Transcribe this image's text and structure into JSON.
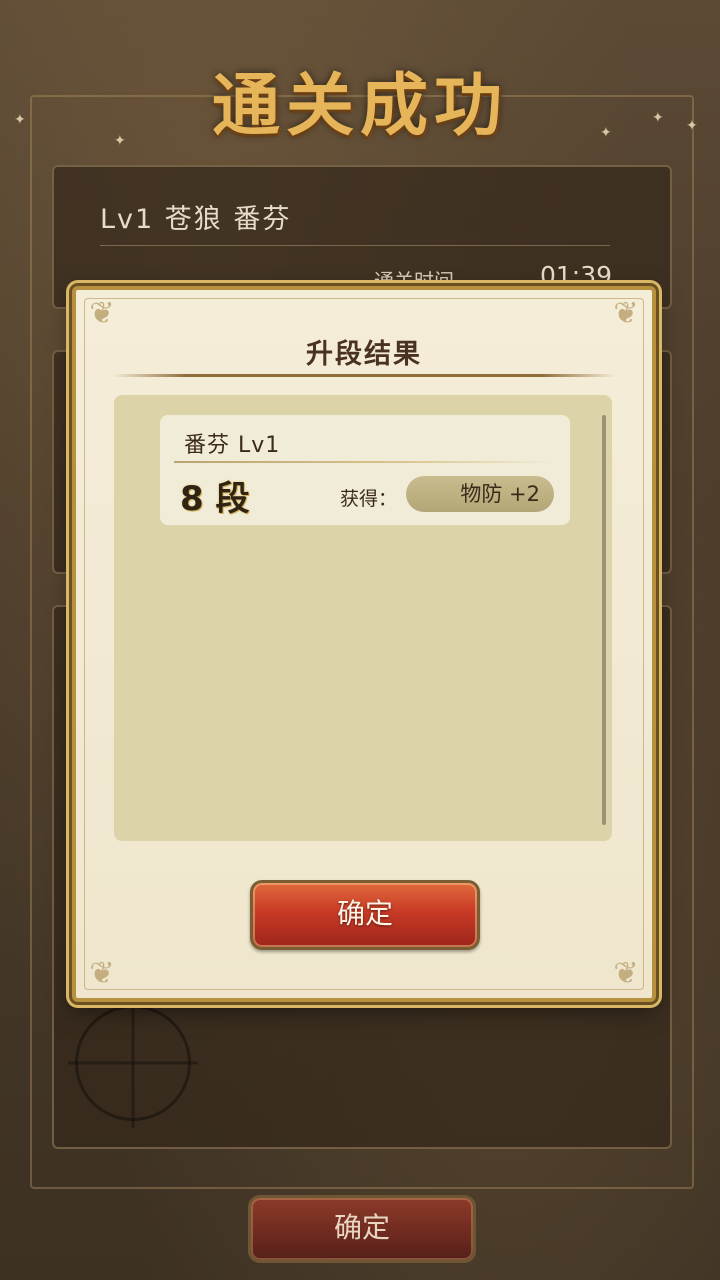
{
  "header": {
    "title": "通关成功"
  },
  "stage_panel": {
    "level": "Lv1  苍狼  番芬",
    "clear_time_label": "通关时间",
    "clear_time_value": "01:39"
  },
  "bottom_button": {
    "label": "确定"
  },
  "dialog": {
    "title": "升段结果",
    "results": [
      {
        "name": "番芬  Lv1",
        "rank": "8 段",
        "gain_label": "获得：",
        "gain_value": "物防 +2"
      }
    ],
    "confirm_label": "确定"
  },
  "colors": {
    "title_gold": "#e6b55a",
    "dialog_bg": "#f4edd8",
    "button_red": "#c83a26",
    "result_area": "#ddd3a8"
  }
}
